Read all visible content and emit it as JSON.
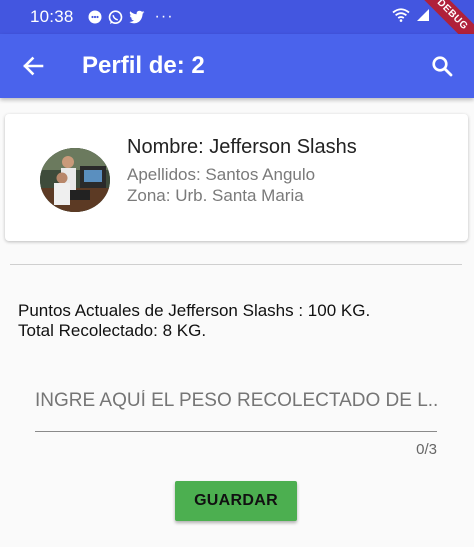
{
  "status_bar": {
    "time": "10:38",
    "more": "···",
    "debug_label": "DEBUG"
  },
  "app_bar": {
    "title": "Perfil de: 2",
    "back_icon": "arrow-back-icon",
    "search_icon": "search-icon"
  },
  "profile": {
    "name": "Nombre: Jefferson Slashs",
    "surnames": "Apellidos: Santos Angulo",
    "zone": "Zona: Urb. Santa Maria"
  },
  "points": {
    "current": "Puntos Actuales de Jefferson Slashs : 100 KG.",
    "total": "Total Recolectado: 8 KG."
  },
  "weight_input": {
    "placeholder": "INGRE AQUÍ EL PESO RECOLECTADO DE L...",
    "value": "",
    "counter": "0/3"
  },
  "save_button": {
    "label": "GUARDAR"
  },
  "colors": {
    "status_bar": "#4356e0",
    "app_bar": "#4a63ec",
    "save_button": "#4caf50",
    "debug_banner": "#b0213b"
  }
}
